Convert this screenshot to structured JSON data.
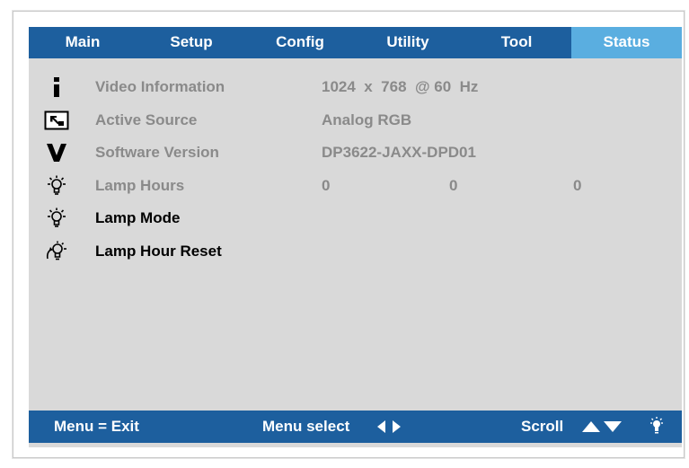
{
  "tabs": [
    {
      "label": "Main",
      "active": false
    },
    {
      "label": "Setup",
      "active": false
    },
    {
      "label": "Config",
      "active": false
    },
    {
      "label": "Utility",
      "active": false
    },
    {
      "label": "Tool",
      "active": false
    },
    {
      "label": "Status",
      "active": true
    }
  ],
  "rows": [
    {
      "icon": "info-icon",
      "label": "Video Information",
      "value": "1024  x  768  @ 60  Hz"
    },
    {
      "icon": "input-source-icon",
      "label": "Active Source",
      "value": "Analog RGB"
    },
    {
      "icon": "version-icon",
      "label": "Software Version",
      "value": "DP3622-JAXX-DPD01"
    },
    {
      "icon": "lamp-icon",
      "label": "Lamp Hours",
      "values": [
        "0",
        "0",
        "0"
      ]
    },
    {
      "icon": "lamp-icon",
      "label": "Lamp Mode"
    },
    {
      "icon": "lamp-reset-icon",
      "label": "Lamp Hour Reset"
    }
  ],
  "footer": {
    "exit": "Menu = Exit",
    "select": "Menu select",
    "scroll": "Scroll"
  },
  "colors": {
    "bar": "#1d5f9e",
    "active_tab": "#5aaee0",
    "panel": "#d9d9d9",
    "disabled_text": "#8a8a8a"
  }
}
